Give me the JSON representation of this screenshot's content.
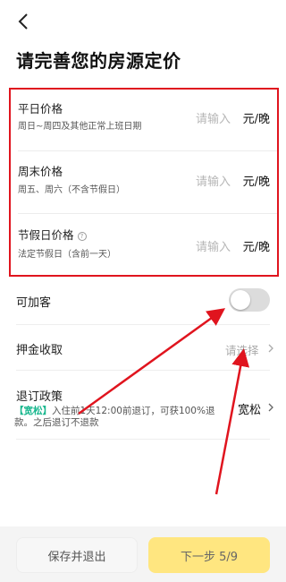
{
  "header": {
    "title": "请完善您的房源定价"
  },
  "prices": [
    {
      "label": "平日价格",
      "sub": "周日~周四及其他正常上班日期",
      "placeholder": "请输入",
      "unit": "元/晚"
    },
    {
      "label": "周末价格",
      "sub": "周五、周六（不含节假日）",
      "placeholder": "请输入",
      "unit": "元/晚"
    },
    {
      "label": "节假日价格",
      "help": "?",
      "sub": "法定节假日（含前一天）",
      "placeholder": "请输入",
      "unit": "元/晚"
    }
  ],
  "extra_guest": {
    "label": "可加客",
    "enabled": false
  },
  "deposit": {
    "label": "押金收取",
    "value": "请选择"
  },
  "cancel_policy": {
    "label": "退订政策",
    "tag": "【宽松】",
    "desc": "入住前1天12:00前退订，可获100%退款。之后退订不退款",
    "level": "宽松"
  },
  "footer": {
    "save_exit": "保存并退出",
    "next": "下一步 5/9"
  },
  "colors": {
    "highlight": "#e0141e",
    "primary": "#ffe680",
    "tag": "#18b78e"
  }
}
